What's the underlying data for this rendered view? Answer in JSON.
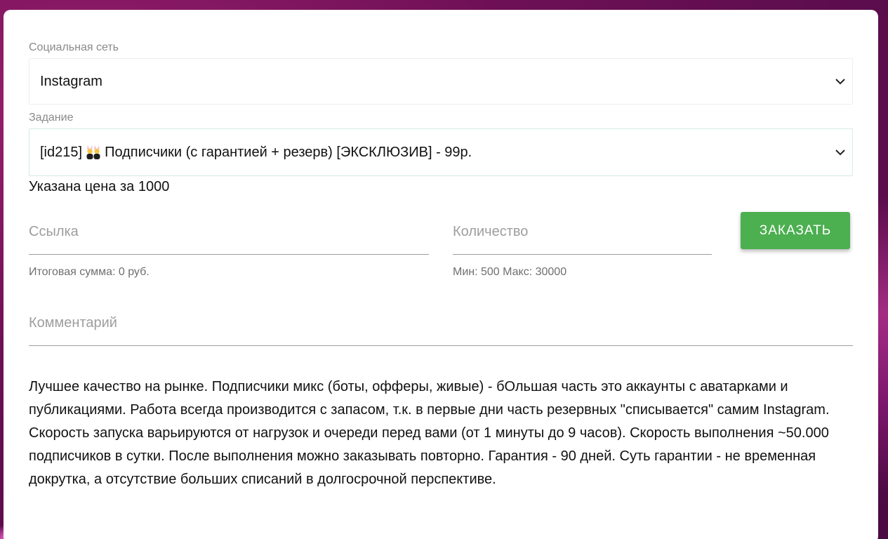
{
  "form": {
    "network": {
      "label": "Социальная сеть",
      "value": "Instagram"
    },
    "task": {
      "label": "Задание",
      "value_prefix": "[id215]",
      "value_emoji": "people-with-bunny-ears-icon",
      "value_suffix": "Подписчики (с гарантией + резерв) [ЭКСКЛЮЗИВ] - 99р."
    },
    "price_note": "Указана цена за 1000",
    "link": {
      "placeholder": "Ссылка",
      "helper": "Итоговая сумма: 0 руб."
    },
    "quantity": {
      "placeholder": "Количество",
      "helper": "Мин: 500 Макс: 30000"
    },
    "order_button": "ЗАКАЗАТЬ",
    "comment": {
      "placeholder": "Комментарий"
    },
    "description": "Лучшее качество на рынке. Подписчики микс (боты, офферы, живые) - бОльшая часть это аккаунты с аватарками и публикациями. Работа всегда производится с запасом, т.к. в первые дни часть резервных \"списывается\" самим Instagram. Скорость запуска варьируются от нагрузок и очереди перед вами (от 1 минуты до 9 часов). Скорость выполнения ~50.000 подписчиков в сутки. После выполнения можно заказывать повторно. Гарантия - 90 дней. Суть гарантии - не временная докрутка, а отсутствие больших списаний в долгосрочной перспективе."
  },
  "colors": {
    "accent": "#4caf50",
    "background": "#6e1056",
    "placeholder": "#9e9e9e"
  }
}
